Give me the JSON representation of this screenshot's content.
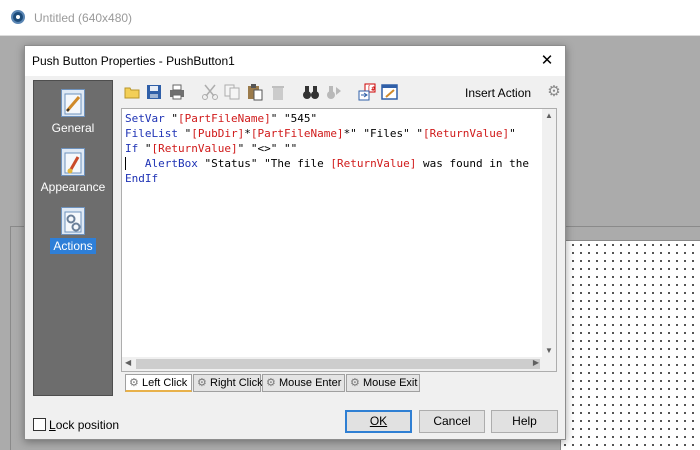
{
  "main_window": {
    "title": "Untitled (640x480)"
  },
  "dialog": {
    "title": "Push Button Properties - PushButton1",
    "close_glyph": "✕"
  },
  "sidebar": {
    "items": [
      {
        "label": "General",
        "icon": "pencil-ruler-icon"
      },
      {
        "label": "Appearance",
        "icon": "paintbrush-icon"
      },
      {
        "label": "Actions",
        "icon": "gears-icon",
        "selected": true
      }
    ]
  },
  "toolbar": {
    "buttons": [
      "open-icon",
      "save-icon",
      "print-icon",
      "cut-icon",
      "copy-icon",
      "paste-icon",
      "delete-icon",
      "find-icon",
      "replace-icon",
      "variable-insert-icon",
      "script-editor-icon"
    ],
    "insert_action_label": "Insert Action"
  },
  "code": {
    "lines": [
      [
        [
          "kw",
          "SetVar "
        ],
        [
          "st",
          "\""
        ],
        [
          "var",
          "[PartFileName]"
        ],
        [
          "st",
          "\" \"545\""
        ]
      ],
      [
        [
          "kw",
          "FileList "
        ],
        [
          "st",
          "\""
        ],
        [
          "var",
          "[PubDir]"
        ],
        [
          "st",
          "*"
        ],
        [
          "var",
          "[PartFileName]"
        ],
        [
          "st",
          "*\" \"Files\" \""
        ],
        [
          "var",
          "[ReturnValue]"
        ],
        [
          "st",
          "\""
        ]
      ],
      [
        [
          "kw",
          "If "
        ],
        [
          "st",
          "\""
        ],
        [
          "var",
          "[ReturnValue]"
        ],
        [
          "st",
          "\" \"<>\" \"\""
        ]
      ],
      [
        [
          "st",
          "   "
        ],
        [
          "kw",
          "AlertBox "
        ],
        [
          "st",
          "\"Status\" \"The file "
        ],
        [
          "var",
          "[ReturnValue]"
        ],
        [
          "st",
          " was found in the"
        ]
      ],
      [
        [
          "kw",
          "EndIf"
        ]
      ]
    ]
  },
  "event_tabs": [
    {
      "label": "Left Click",
      "active": true
    },
    {
      "label": "Right Click"
    },
    {
      "label": "Mouse Enter"
    },
    {
      "label": "Mouse Exit"
    }
  ],
  "footer": {
    "lock_label": "Lock position",
    "lock_checked": false,
    "ok_label": "OK",
    "cancel_label": "Cancel",
    "help_label": "Help"
  },
  "colors": {
    "keyword": "#1f33b5",
    "variable": "#d01a1a",
    "selected_tab": "#2e7fd8",
    "sidebar": "#6d6d6d"
  }
}
